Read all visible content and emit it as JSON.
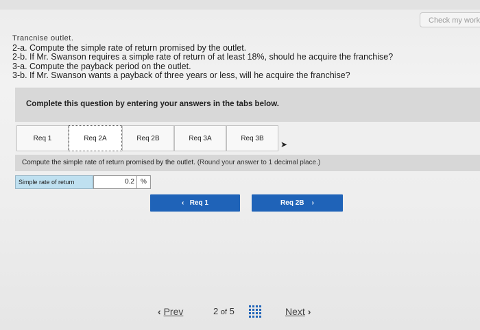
{
  "header": {
    "check_label": "Check my work"
  },
  "questions": [
    "Trancnise outlet.",
    "2-a. Compute the simple rate of return promised by the outlet.",
    "2-b. If Mr. Swanson requires a simple rate of return of at least 18%, should he acquire the franchise?",
    "3-a. Compute the payback period on the outlet.",
    "3-b. If Mr. Swanson wants a payback of three years or less, will he acquire the franchise?"
  ],
  "panel": {
    "title": "Complete this question by entering your answers in the tabs below."
  },
  "tabs": [
    {
      "label": "Req 1"
    },
    {
      "label": "Req 2A"
    },
    {
      "label": "Req 2B"
    },
    {
      "label": "Req 3A"
    },
    {
      "label": "Req 3B"
    }
  ],
  "instruction": {
    "main": "Compute the simple rate of return promised by the outlet.",
    "hint": "(Round your answer to 1 decimal place.)"
  },
  "answer": {
    "label": "Simple rate of return",
    "value": "0.2",
    "unit": "%"
  },
  "nav": {
    "prev_label": "Req 1",
    "next_label": "Req 2B"
  },
  "pager": {
    "prev_label": "Prev",
    "current": "2",
    "of_label": "of",
    "total": "5",
    "next_label": "Next"
  },
  "colors": {
    "button_blue": "#1f63b8",
    "answer_label_bg": "#bfe0f0"
  }
}
